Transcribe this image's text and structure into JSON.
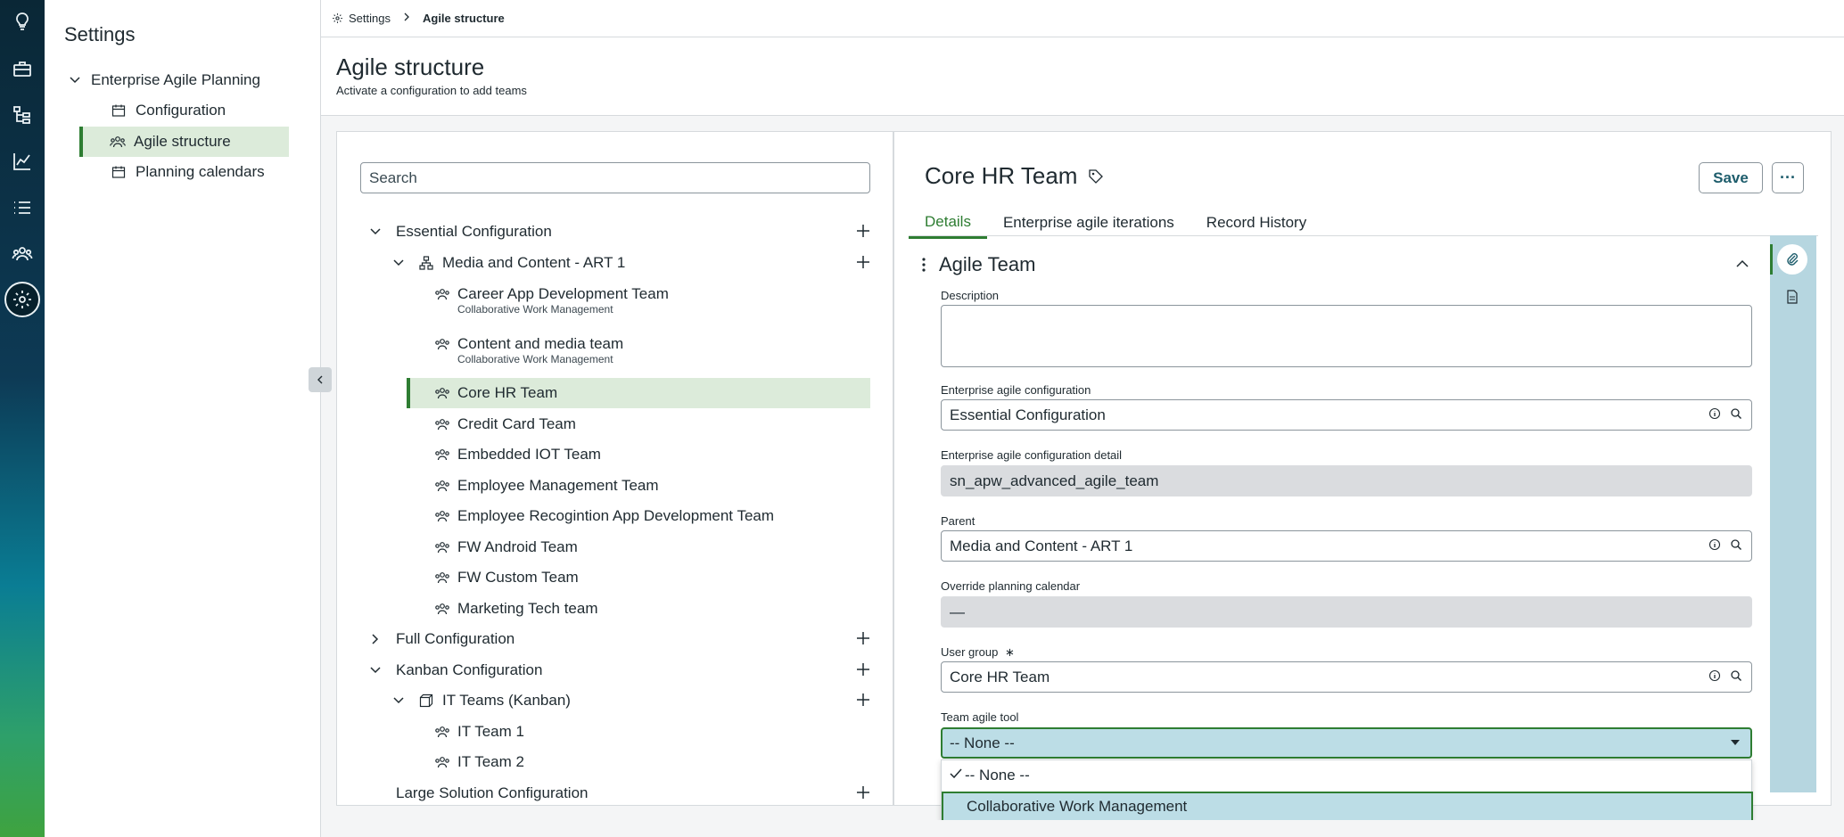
{
  "rail": {
    "icons": [
      "lightbulb-icon",
      "briefcase-icon",
      "hierarchy-icon",
      "line-chart-icon",
      "list-icon",
      "team-icon",
      "gear-icon"
    ]
  },
  "sidebar": {
    "title": "Settings",
    "group_label": "Enterprise Agile Planning",
    "items": [
      {
        "label": "Configuration"
      },
      {
        "label": "Agile structure"
      },
      {
        "label": "Planning calendars"
      }
    ]
  },
  "breadcrumb": {
    "root": "Settings",
    "current": "Agile structure"
  },
  "page": {
    "title": "Agile structure",
    "subtitle": "Activate a configuration to add teams"
  },
  "tree": {
    "search_placeholder": "Search",
    "nodes": [
      {
        "label": "Essential Configuration"
      },
      {
        "label": "Media and Content - ART 1"
      },
      {
        "label": "Career App Development Team",
        "sub": "Collaborative Work Management"
      },
      {
        "label": "Content and media team",
        "sub": "Collaborative Work Management"
      },
      {
        "label": "Core HR Team"
      },
      {
        "label": "Credit Card Team"
      },
      {
        "label": "Embedded IOT Team"
      },
      {
        "label": "Employee Management Team"
      },
      {
        "label": "Employee Recogintion App Development Team"
      },
      {
        "label": "FW Android Team"
      },
      {
        "label": "FW Custom Team"
      },
      {
        "label": "Marketing Tech team"
      },
      {
        "label": "Full Configuration"
      },
      {
        "label": "Kanban Configuration"
      },
      {
        "label": "IT Teams (Kanban)"
      },
      {
        "label": "IT Team 1"
      },
      {
        "label": "IT Team 2"
      },
      {
        "label": "Large Solution Configuration"
      }
    ]
  },
  "record": {
    "title": "Core HR Team",
    "save_label": "Save",
    "more_label": "···",
    "tabs": [
      {
        "label": "Details"
      },
      {
        "label": "Enterprise agile iterations"
      },
      {
        "label": "Record History"
      }
    ],
    "section_title": "Agile Team",
    "fields": {
      "description_label": "Description",
      "config_label": "Enterprise agile configuration",
      "config_value": "Essential Configuration",
      "config_detail_label": "Enterprise agile configuration detail",
      "config_detail_value": "sn_apw_advanced_agile_team",
      "parent_label": "Parent",
      "parent_value": "Media and Content - ART 1",
      "override_label": "Override planning calendar",
      "override_value": "—",
      "user_group_label": "User group",
      "user_group_required": "∗",
      "user_group_value": "Core HR Team",
      "tool_label": "Team agile tool",
      "tool_value": "-- None --"
    },
    "tool_options": [
      {
        "label": "-- None --",
        "selected": true
      },
      {
        "label": "Collaborative Work Management",
        "highlighted": true
      }
    ]
  },
  "colors": {
    "accent_green": "#2e7d32",
    "selected_bg": "#dcebda",
    "highlight_blue": "#bcdde6"
  }
}
